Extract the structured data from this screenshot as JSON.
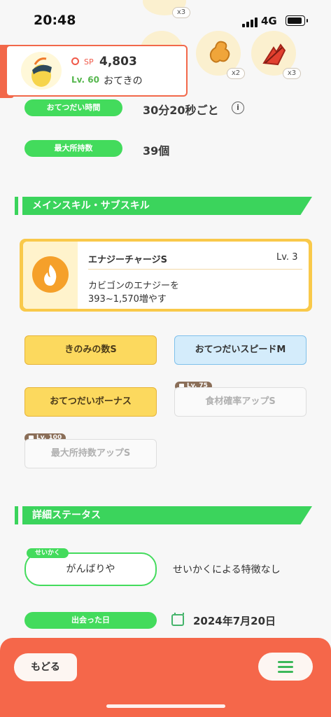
{
  "status_bar": {
    "time": "20:48",
    "network": "4G"
  },
  "berries": [
    {
      "name": "top-berry",
      "count": "x3"
    },
    {
      "name": "ginger-berry",
      "count": "x2"
    },
    {
      "name": "red-berry",
      "count": "x3"
    }
  ],
  "pokemon_card": {
    "sp_label": "SP",
    "sp_value": "4,803",
    "level": "Lv. 60",
    "nickname": "おてきの"
  },
  "stats": {
    "help_time_label": "おてつだい時間",
    "help_time_value": "30分20秒ごと",
    "info_glyph": "i",
    "max_carry_label": "最大所持数",
    "max_carry_value": "39個"
  },
  "skills_section": {
    "title": "メインスキル・サブスキル",
    "main_skill": {
      "name": "エナジーチャージS",
      "level": "Lv. 3",
      "desc_line1": "カビゴンのエナジーを",
      "desc_line2": "393~1,570増やす"
    },
    "sub_skills": [
      {
        "label": "きのみの数S",
        "lock": ""
      },
      {
        "label": "おてつだいスピードM",
        "lock": ""
      },
      {
        "label": "おてつだいボーナス",
        "lock": ""
      },
      {
        "label": "食材確率アップS",
        "lock": "Lv. 75"
      },
      {
        "label": "最大所持数アップS",
        "lock": "Lv. 100"
      }
    ]
  },
  "details_section": {
    "title": "詳細ステータス",
    "nature_tag": "せいかく",
    "nature_value": "がんばりや",
    "nature_desc": "せいかくによる特徴なし",
    "met_label": "出会った日",
    "met_date": "2024年7月20日"
  },
  "bottom_bar": {
    "back_label": "もどる"
  },
  "colors": {
    "accent_green": "#43db5c",
    "accent_orange": "#f5674a",
    "gold": "#fcd95e"
  }
}
